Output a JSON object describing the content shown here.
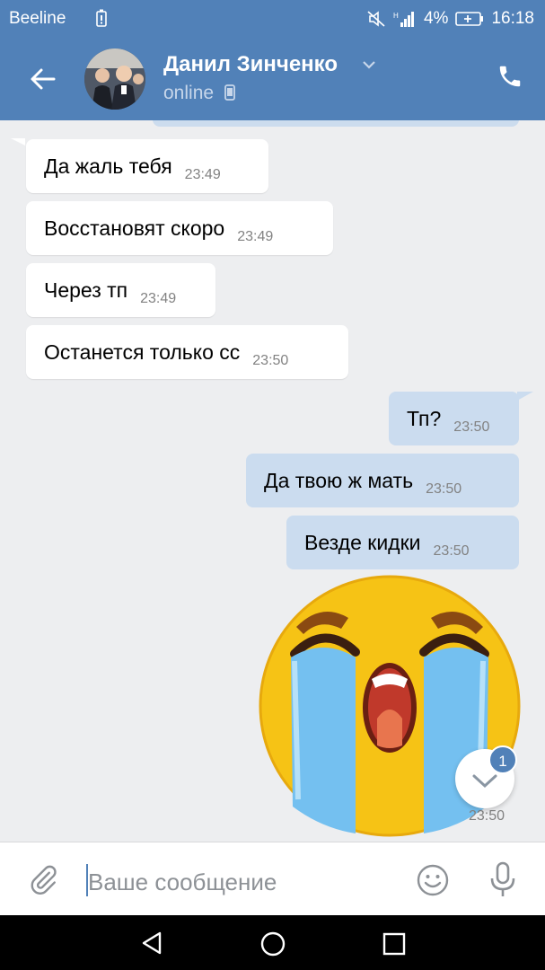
{
  "status_bar": {
    "carrier": "Beeline",
    "battery": "4%",
    "time": "16:18"
  },
  "header": {
    "name": "Данил Зинченко",
    "status": "online"
  },
  "messages": [
    {
      "dir": "in",
      "text": "Да жаль тебя",
      "time": "23:49"
    },
    {
      "dir": "in",
      "text": "Восстановят скоро",
      "time": "23:49"
    },
    {
      "dir": "in",
      "text": "Через тп",
      "time": "23:49"
    },
    {
      "dir": "in",
      "text": "Останется только сс",
      "time": "23:50"
    },
    {
      "dir": "out",
      "text": "Тп?",
      "time": "23:50"
    },
    {
      "dir": "out",
      "text": "Да твою ж мать",
      "time": "23:50"
    },
    {
      "dir": "out",
      "text": "Везде кидки",
      "time": "23:50"
    }
  ],
  "sticker": {
    "name": "crying-face-sticker",
    "time": "23:50"
  },
  "scroll_down": {
    "unread_count": "1"
  },
  "composer": {
    "placeholder": "Ваше сообщение"
  },
  "colors": {
    "accent": "#5181b8",
    "outgoing_bubble": "#cbdcef",
    "background": "#edeef0"
  },
  "icons": [
    "back-arrow-icon",
    "phone-icon",
    "paperclip-icon",
    "smile-icon",
    "microphone-icon",
    "nav-back-icon",
    "nav-home-icon",
    "nav-recents-icon"
  ]
}
